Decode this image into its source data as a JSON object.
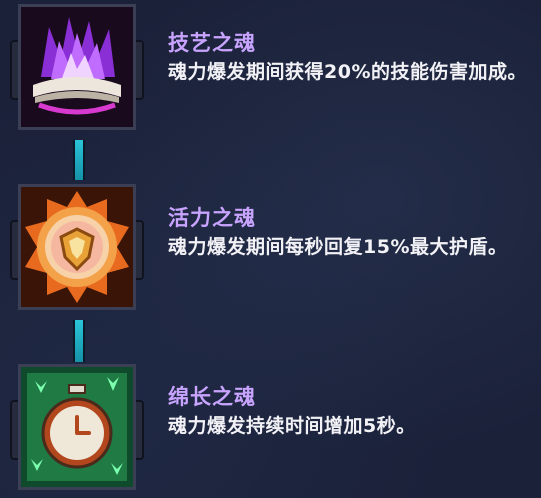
{
  "skills": [
    {
      "title": "技艺之魂",
      "description": "魂力爆发期间获得20%的技能伤害加成。",
      "icon": "purple-flame-book-icon"
    },
    {
      "title": "活力之魂",
      "description": "魂力爆发期间每秒回复15%最大护盾。",
      "icon": "orange-shield-icon"
    },
    {
      "title": "绵长之魂",
      "description": "魂力爆发持续时间增加5秒。",
      "icon": "green-stopwatch-icon"
    }
  ],
  "colors": {
    "title": "#c8a4ff",
    "description": "#f2f2f6",
    "connector": "#2bc4d8",
    "background": "#1b2139"
  }
}
